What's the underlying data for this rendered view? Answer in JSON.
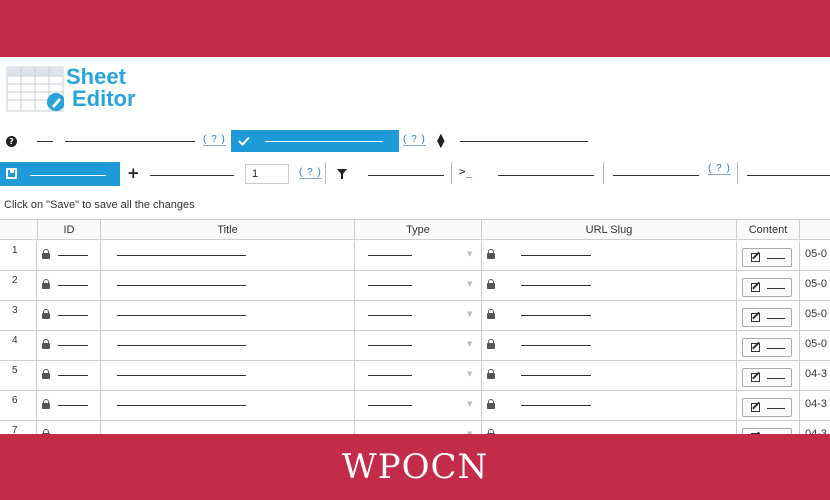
{
  "app": {
    "logo_line1": "Sheet",
    "logo_line2": "Editor"
  },
  "toolbar": {
    "help_glyph": "?",
    "help_link_1": "( ? )",
    "help_link_2": "( ? )",
    "help_link_3": "( ? )",
    "quantity_value": "1",
    "quantity_help": "( ? )",
    "terminal_glyph": ">_",
    "accent_color": "#1d9ad7"
  },
  "hint": "Click on \"Save\" to save all the changes",
  "table": {
    "columns": [
      "ID",
      "Title",
      "Type",
      "URL Slug",
      "Content"
    ],
    "rows": [
      {
        "num": "1",
        "date": "05-0"
      },
      {
        "num": "2",
        "date": "05-0"
      },
      {
        "num": "3",
        "date": "05-0"
      },
      {
        "num": "4",
        "date": "05-0"
      },
      {
        "num": "5",
        "date": "04-3"
      },
      {
        "num": "6",
        "date": "04-3"
      },
      {
        "num": "7",
        "date": "04-3"
      }
    ]
  },
  "watermark": "WPOCN",
  "colors": {
    "brand_band": "#c22c48",
    "logo": "#2aa3d8"
  }
}
